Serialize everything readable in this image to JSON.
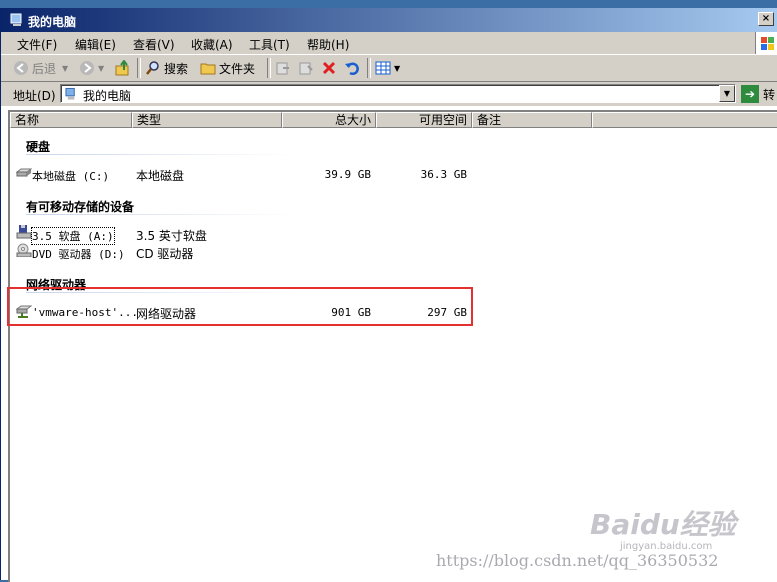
{
  "window": {
    "title": "我的电脑"
  },
  "menu": [
    "文件(F)",
    "编辑(E)",
    "查看(V)",
    "收藏(A)",
    "工具(T)",
    "帮助(H)"
  ],
  "toolbar": {
    "back": "后退",
    "search": "搜索",
    "folders": "文件夹"
  },
  "address": {
    "label": "地址(D)",
    "value": "我的电脑",
    "go": "转"
  },
  "columns": [
    "名称",
    "类型",
    "总大小",
    "可用空间",
    "备注"
  ],
  "groups": [
    {
      "title": "硬盘",
      "items": [
        {
          "name": "本地磁盘 (C:)",
          "type": "本地磁盘",
          "total": "39.9 GB",
          "free": "36.3 GB"
        }
      ]
    },
    {
      "title": "有可移动存储的设备",
      "items": [
        {
          "name": "3.5 软盘 (A:)",
          "type": "3.5 英寸软盘",
          "total": "",
          "free": ""
        },
        {
          "name": "DVD 驱动器 (D:)",
          "type": "CD 驱动器",
          "total": "",
          "free": ""
        }
      ]
    },
    {
      "title": "网络驱动器",
      "items": [
        {
          "name": "'vmware-host'...",
          "type": "网络驱动器",
          "total": "901 GB",
          "free": "297 GB"
        }
      ]
    }
  ],
  "watermark": {
    "logo": "Baidu经验",
    "sub": "jingyan.baidu.com",
    "url": "https://blog.csdn.net/qq_36350532"
  },
  "colors": {
    "highlight": "#e53030",
    "titlebar": "#0a246a"
  }
}
